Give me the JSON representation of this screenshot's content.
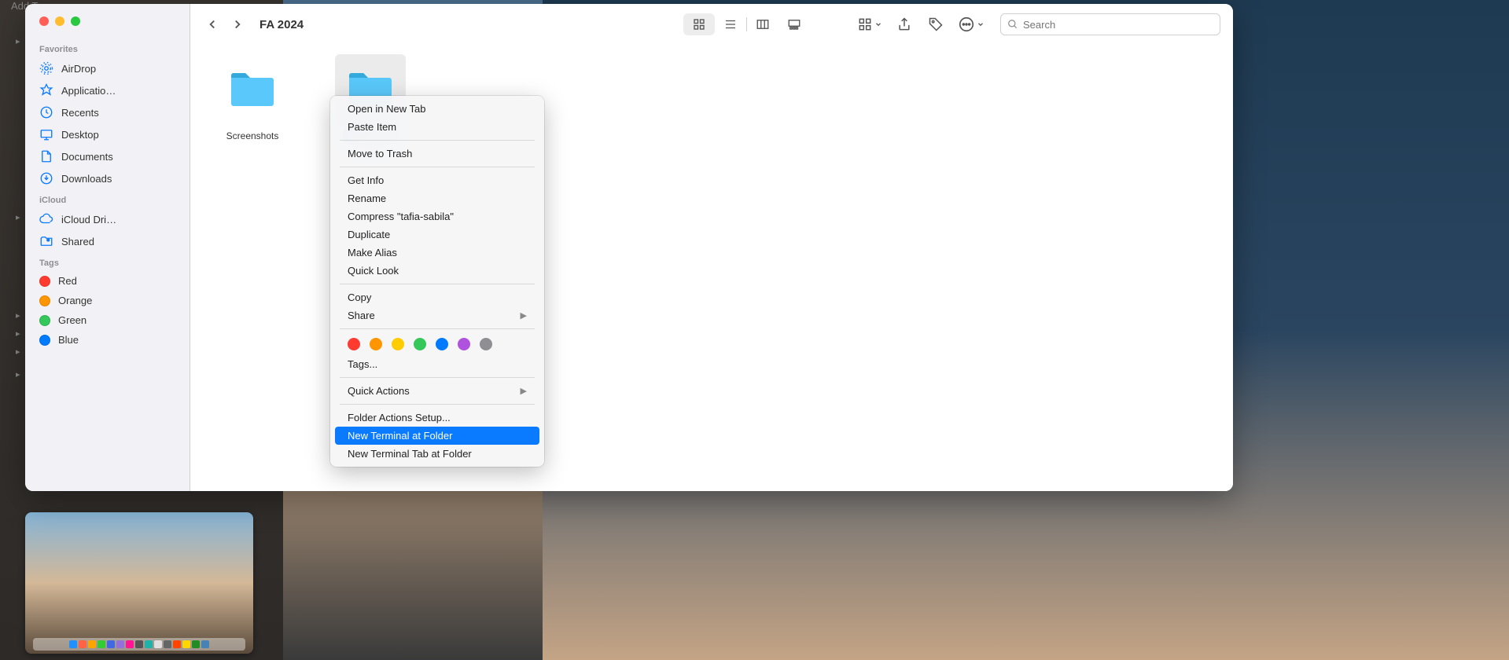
{
  "window": {
    "title": "FA 2024"
  },
  "search": {
    "placeholder": "Search"
  },
  "sidebar": {
    "sections": {
      "favorites_title": "Favorites",
      "icloud_title": "iCloud",
      "tags_title": "Tags"
    },
    "favorites": [
      {
        "label": "AirDrop",
        "icon": "airdrop"
      },
      {
        "label": "Applicatio…",
        "icon": "apps"
      },
      {
        "label": "Recents",
        "icon": "recents"
      },
      {
        "label": "Desktop",
        "icon": "desktop"
      },
      {
        "label": "Documents",
        "icon": "documents"
      },
      {
        "label": "Downloads",
        "icon": "downloads"
      }
    ],
    "icloud": [
      {
        "label": "iCloud Dri…",
        "icon": "cloud"
      },
      {
        "label": "Shared",
        "icon": "shared"
      }
    ],
    "tags": [
      {
        "label": "Red",
        "color": "#ff3b30"
      },
      {
        "label": "Orange",
        "color": "#ff9500"
      },
      {
        "label": "Green",
        "color": "#34c759"
      },
      {
        "label": "Blue",
        "color": "#007aff"
      }
    ]
  },
  "folders": [
    {
      "label": "Screenshots",
      "selected": false
    },
    {
      "label": "tafia-sabila",
      "selected": true
    }
  ],
  "context_menu": {
    "open_new_tab": "Open in New Tab",
    "paste_item": "Paste Item",
    "move_to_trash": "Move to Trash",
    "get_info": "Get Info",
    "rename": "Rename",
    "compress": "Compress \"tafia-sabila\"",
    "duplicate": "Duplicate",
    "make_alias": "Make Alias",
    "quick_look": "Quick Look",
    "copy": "Copy",
    "share": "Share",
    "tags": "Tags...",
    "quick_actions": "Quick Actions",
    "folder_actions_setup": "Folder Actions Setup...",
    "new_terminal_at_folder": "New Terminal at Folder",
    "new_terminal_tab_at_folder": "New Terminal Tab at Folder",
    "tag_colors": [
      "#ff3b30",
      "#ff9500",
      "#ffcc00",
      "#34c759",
      "#007aff",
      "#af52de",
      "#8e8e93"
    ]
  },
  "bg": {
    "add_tags": "Add Tags"
  }
}
